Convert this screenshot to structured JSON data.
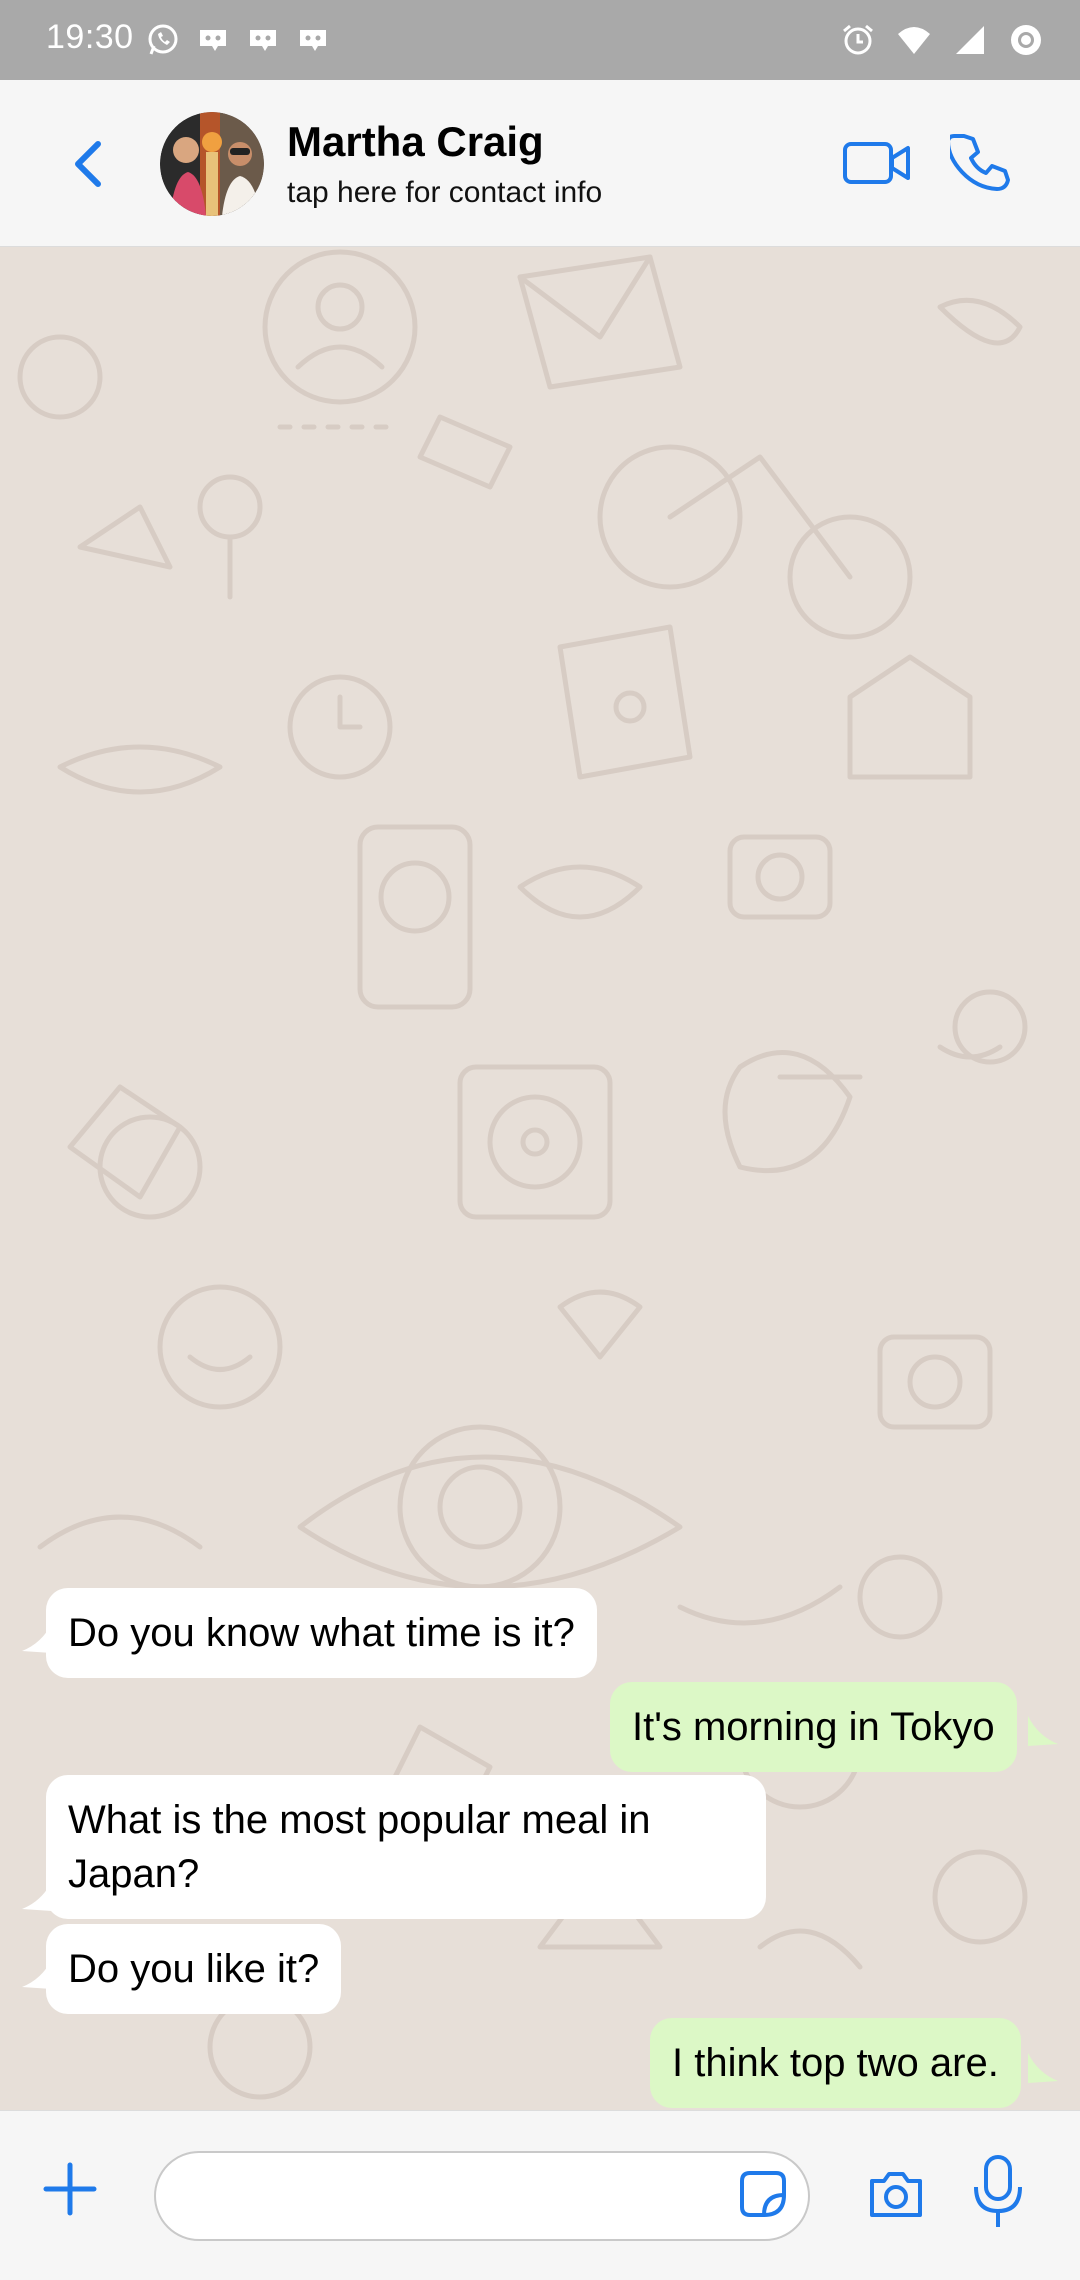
{
  "status_bar": {
    "time": "19:30",
    "left_icons": [
      "whatsapp-icon",
      "discord-icon",
      "discord-icon",
      "discord-icon"
    ],
    "right_icons": [
      "alarm-icon",
      "wifi-icon",
      "signal-icon",
      "battery-icon"
    ]
  },
  "header": {
    "contact_name": "Martha Craig",
    "subtitle": "tap here for contact info",
    "accent_color": "#1f7aea"
  },
  "messages": [
    {
      "direction": "in",
      "text": "Do you know what time is it?"
    },
    {
      "direction": "out",
      "text": "It's morning in Tokyo"
    },
    {
      "direction": "in",
      "text": "What is the most popular meal in\nJapan?"
    },
    {
      "direction": "in",
      "text": "Do you like it?"
    },
    {
      "direction": "out",
      "text": "I think top two are."
    }
  ],
  "input": {
    "value": "",
    "placeholder": ""
  },
  "colors": {
    "incoming_bubble": "#ffffff",
    "outgoing_bubble": "#dcf8c6",
    "chat_background": "#e7dfd8"
  }
}
